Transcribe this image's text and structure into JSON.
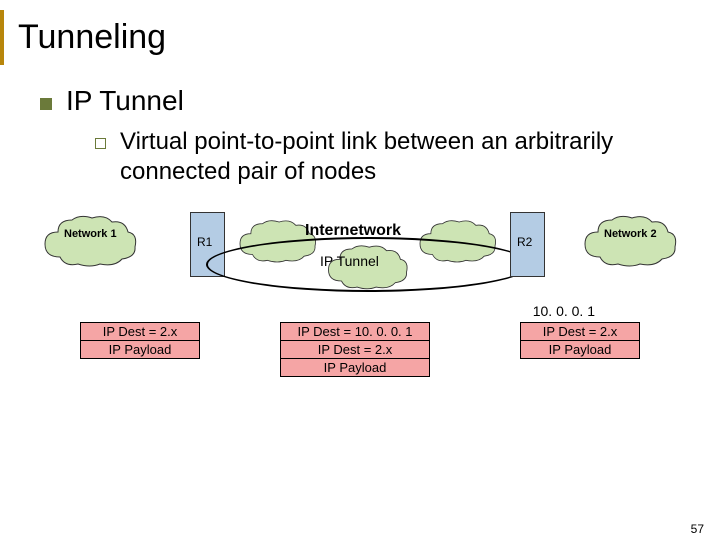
{
  "title": "Tunneling",
  "bullet1": "IP Tunnel",
  "bullet2": "Virtual point-to-point link between an arbitrarily connected pair of nodes",
  "network1": "Network 1",
  "network2": "Network 2",
  "router1": "R1",
  "router2": "R2",
  "internetwork": "Internetwork",
  "tunnel_label": "IP Tunnel",
  "ip_addr": "10. 0. 0. 1",
  "packet1": {
    "line1": "IP Dest = 2.x",
    "line2": "IP Payload"
  },
  "packet2": {
    "line1": "IP Dest = 10. 0. 0. 1",
    "line2": "IP Dest = 2.x",
    "line3": "IP Payload"
  },
  "packet3": {
    "line1": "IP Dest = 2.x",
    "line2": "IP Payload"
  },
  "slide_number": "57"
}
